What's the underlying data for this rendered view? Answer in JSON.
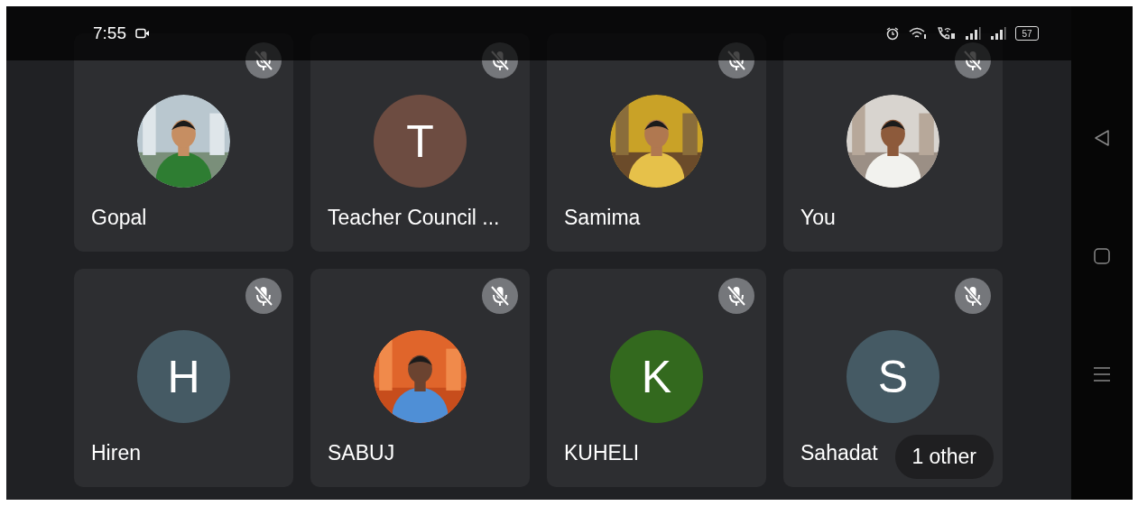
{
  "status_bar": {
    "time": "7:55",
    "battery": "57"
  },
  "participants": [
    {
      "name": "Gopal",
      "muted": true
    },
    {
      "name": "Teacher Council ...",
      "avatar": {
        "kind": "letter",
        "letter": "T",
        "color": "#6d4c41"
      },
      "muted": true
    },
    {
      "name": "Samima",
      "muted": true
    },
    {
      "name": "You",
      "muted": true
    },
    {
      "name": "Hiren",
      "avatar": {
        "kind": "letter",
        "letter": "H",
        "color": "#455a64"
      },
      "muted": true
    },
    {
      "name": "SABUJ",
      "muted": true
    },
    {
      "name": "KUHELI",
      "avatar": {
        "kind": "letter",
        "letter": "K",
        "color": "#33691e"
      },
      "muted": true
    },
    {
      "name": "Sahadat",
      "avatar": {
        "kind": "letter",
        "letter": "S",
        "color": "#455a64"
      },
      "muted": true
    }
  ],
  "overflow_badge": "1 other"
}
